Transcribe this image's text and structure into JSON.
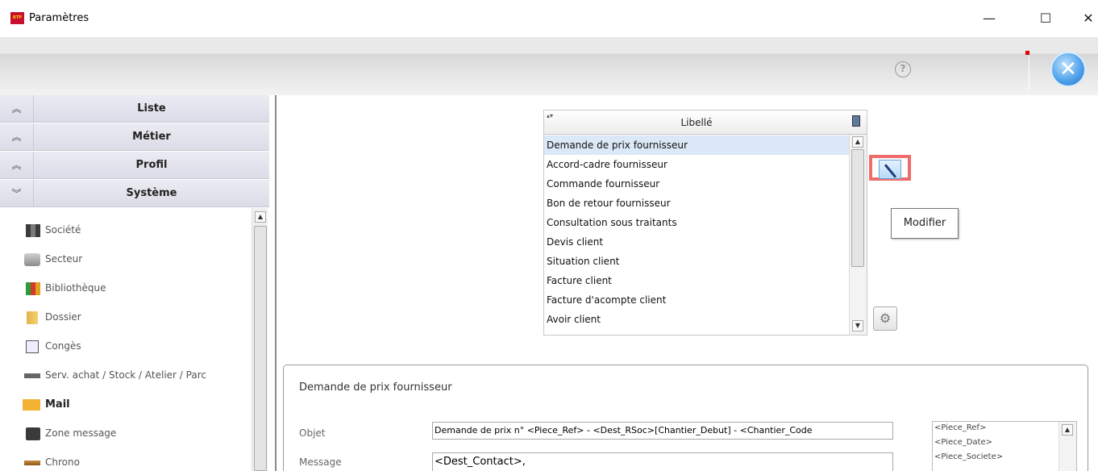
{
  "window": {
    "title": "Paramètres",
    "min": "—",
    "max": "☐",
    "close": "✕"
  },
  "toolbar": {
    "help": "?",
    "close_glyph": "✕"
  },
  "sidebar": {
    "sections": [
      {
        "label": "Liste",
        "chevron": "≈"
      },
      {
        "label": "Métier",
        "chevron": "≈"
      },
      {
        "label": "Profil",
        "chevron": "≈"
      },
      {
        "label": "Système",
        "chevron": "≈"
      }
    ],
    "items": [
      {
        "label": "Société",
        "icon": "building-icon"
      },
      {
        "label": "Secteur",
        "icon": "drive-icon"
      },
      {
        "label": "Bibliothèque",
        "icon": "books-icon"
      },
      {
        "label": "Dossier",
        "icon": "folder-icon"
      },
      {
        "label": "Congès",
        "icon": "calendar-icon"
      },
      {
        "label": "Serv. achat / Stock / Atelier / Parc",
        "icon": "truck-icon"
      },
      {
        "label": "Mail",
        "icon": "mail-icon"
      },
      {
        "label": "Zone message",
        "icon": "message-icon"
      },
      {
        "label": "Chrono",
        "icon": "chrono-icon"
      }
    ]
  },
  "libelle": {
    "header": "Libellé",
    "rows": [
      "Demande de prix fournisseur",
      "Accord-cadre fournisseur",
      "Commande fournisseur",
      "Bon de retour fournisseur",
      "Consultation sous traitants",
      "Devis client",
      "Situation client",
      "Facture client",
      "Facture d'acompte client",
      "Avoir client"
    ],
    "selected_index": 0
  },
  "actions": {
    "modify_tooltip": "Modifier"
  },
  "detail": {
    "title": "Demande de prix fournisseur",
    "objet_label": "Objet",
    "objet_value": "Demande de prix n° <Piece_Ref> - <Dest_RSoc>[Chantier_Debut] - <Chantier_Code",
    "message_label": "Message",
    "message_value": "<Dest_Contact>,",
    "variables": [
      "<Piece_Ref>",
      "<Piece_Date>",
      "<Piece_Societe>"
    ]
  },
  "colors": {
    "highlight": "#f06b6b",
    "selection": "#dbe8f7",
    "accent": "#4a9ee8"
  }
}
